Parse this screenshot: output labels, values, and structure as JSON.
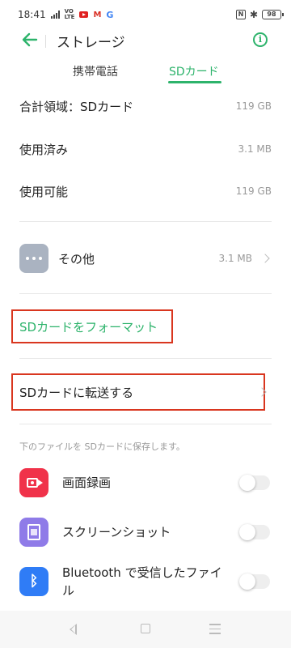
{
  "status_bar": {
    "time": "18:41",
    "vo_top": "VO",
    "vo_bottom": "LTE",
    "m_label": "M",
    "g_label": "G",
    "nfc_label": "N",
    "bt_label": "✱",
    "battery": "98"
  },
  "header": {
    "title": "ストレージ"
  },
  "tabs": {
    "phone": "携帯電話",
    "sd": "SDカード"
  },
  "summary": {
    "total_label": "合計領域：SDカード",
    "total_value": "119 GB",
    "used_label": "使用済み",
    "used_value": "3.1 MB",
    "available_label": "使用可能",
    "available_value": "119 GB"
  },
  "other": {
    "label": "その他",
    "value": "3.1 MB"
  },
  "actions": {
    "format": "SDカードをフォーマット",
    "transfer": "SDカードに転送する"
  },
  "section_note": "下のファイルを SDカードに保存します。",
  "apps": [
    {
      "label": "画面録画",
      "icon": "screen-record-icon"
    },
    {
      "label": "スクリーンショット",
      "icon": "screenshot-icon"
    },
    {
      "label": "Bluetooth で受信したファイル",
      "icon": "bluetooth-icon",
      "glyph": "ᛒ"
    }
  ],
  "colors": {
    "accent": "#2db36b",
    "highlight_border": "#d9361f"
  }
}
